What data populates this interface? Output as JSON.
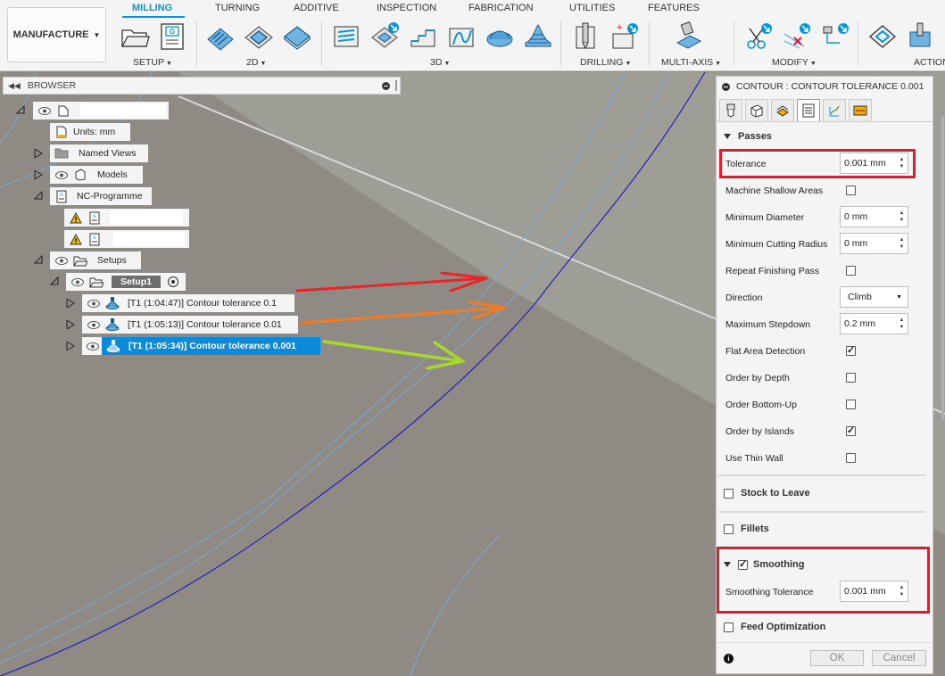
{
  "ribbon": {
    "workspace": "MANUFACTURE",
    "tabs": [
      "MILLING",
      "TURNING",
      "ADDITIVE",
      "INSPECTION",
      "FABRICATION",
      "UTILITIES",
      "FEATURES"
    ],
    "active_tab": "MILLING",
    "groups": [
      "SETUP",
      "2D",
      "3D",
      "DRILLING",
      "MULTI-AXIS",
      "MODIFY",
      "ACTION"
    ],
    "accent_color": "#0696d7"
  },
  "browser": {
    "title": "BROWSER",
    "units": "Units: mm",
    "named_views": "Named Views",
    "models": "Models",
    "nc_programs": "NC-Programme",
    "setups": "Setups",
    "setup1": "Setup1",
    "operations": [
      "[T1 (1:04:47)] Contour tolerance 0.1",
      "[T1 (1:05:13)] Contour tolerance 0.01",
      "[T1 (1:05:34)] Contour tolerance 0.001"
    ],
    "selected_color": "#0a8ad8"
  },
  "annotations": {
    "arrow_colors": [
      "#e8262a",
      "#f47a22",
      "#a6d92a"
    ],
    "highlight_color": "#e21a2c"
  },
  "panel": {
    "title": "CONTOUR : CONTOUR TOLERANCE 0.001",
    "passes_title": "Passes",
    "tolerance_label": "Tolerance",
    "tolerance_value": "0.001 mm",
    "machine_shallow": "Machine Shallow Areas",
    "min_diameter_label": "Minimum Diameter",
    "min_diameter_value": "0 mm",
    "min_radius_label": "Minimum Cutting Radius",
    "min_radius_value": "0 mm",
    "repeat_finishing": "Repeat Finishing Pass",
    "direction_label": "Direction",
    "direction_value": "Climb",
    "max_stepdown_label": "Maximum Stepdown",
    "max_stepdown_value": "0.2 mm",
    "flat_area": "Flat Area Detection",
    "order_depth": "Order by Depth",
    "order_bottom": "Order Bottom-Up",
    "order_islands": "Order by Islands",
    "thin_wall": "Use Thin Wall",
    "stock_to_leave": "Stock to Leave",
    "fillets": "Fillets",
    "smoothing": "Smoothing",
    "smoothing_tol_label": "Smoothing Tolerance",
    "smoothing_tol_value": "0.001 mm",
    "feed_opt": "Feed Optimization",
    "ok": "OK",
    "cancel": "Cancel"
  }
}
